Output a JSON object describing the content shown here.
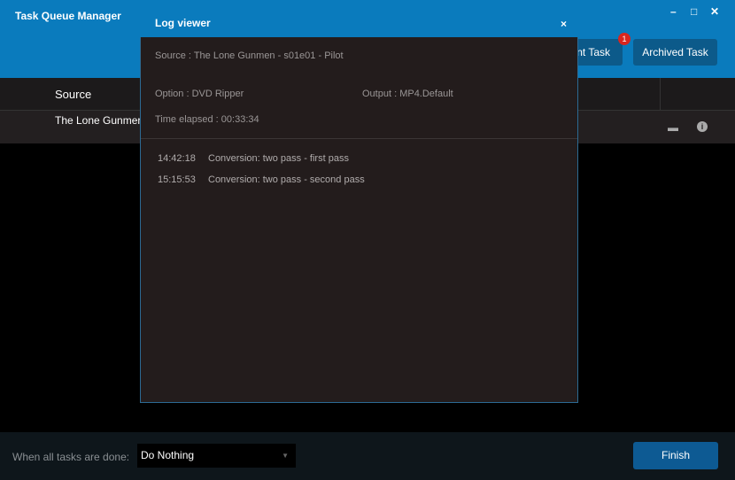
{
  "window": {
    "title": "Task Queue Manager",
    "minimize": "–",
    "maximize": "□",
    "close": "✕"
  },
  "toolbar": {
    "current_task": "nt Task",
    "badge": "1",
    "archived_task": "Archived Task"
  },
  "table": {
    "header_source": "Source",
    "rows": [
      {
        "source": "The Lone Gunmer"
      }
    ]
  },
  "footer": {
    "label": "When all tasks are done:",
    "select_value": "Do Nothing",
    "finish": "Finish"
  },
  "log": {
    "title": "Log viewer",
    "close": "×",
    "source": "Source : The Lone Gunmen - s01e01 - Pilot",
    "option": "Option : DVD Ripper",
    "output": "Output : MP4.Default",
    "elapsed": "Time elapsed : 00:33:34",
    "entries": [
      {
        "time": "14:42:18",
        "msg": "Conversion: two pass - first pass"
      },
      {
        "time": "15:15:53",
        "msg": "Conversion: two pass - second pass"
      }
    ]
  }
}
